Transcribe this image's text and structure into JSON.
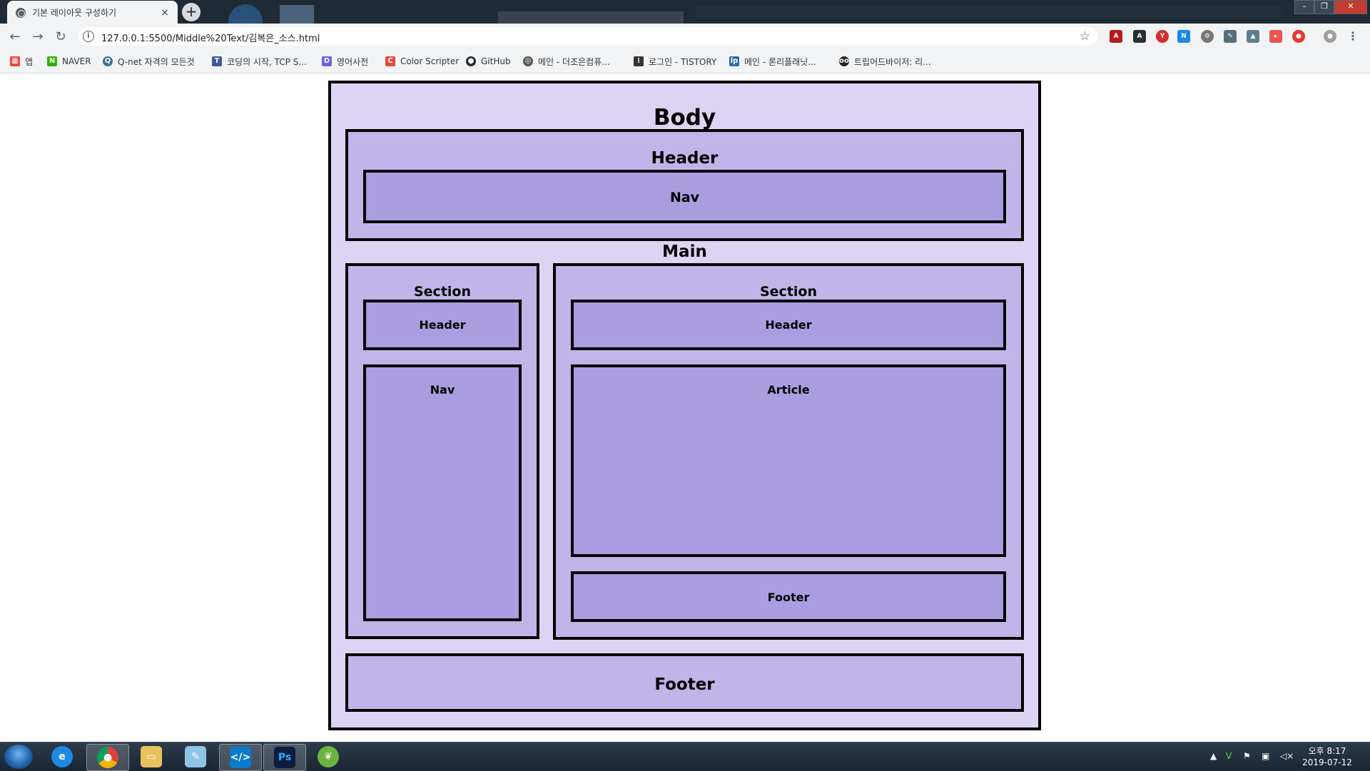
{
  "browser": {
    "tab_title": "기본 레이아웃 구성하기",
    "tab_close": "×",
    "new_tab": "+",
    "url": "127.0.0.1:5500/Middle%20Text/김복은_소스.html",
    "window_controls": [
      "–",
      "❐",
      "✕"
    ],
    "bookmarks": [
      {
        "label": "앱",
        "icon": "apps-grid-icon",
        "color": "#e8453c"
      },
      {
        "label": "NAVER",
        "icon": "naver-icon",
        "color": "#2db400"
      },
      {
        "label": "Q-net 자격의 모든것",
        "icon": "qnet-icon",
        "color": "#3a6f8f"
      },
      {
        "label": "코딩의 시작, TCP S...",
        "icon": "tcp-school-icon",
        "color": "#3b5b9a"
      },
      {
        "label": "영어사전",
        "icon": "dictionary-icon",
        "color": "#6c5ce7"
      },
      {
        "label": "Color Scripter",
        "icon": "color-scripter-icon",
        "color": "#e24a3a"
      },
      {
        "label": "GitHub",
        "icon": "github-icon",
        "color": "#24292e"
      },
      {
        "label": "메인 - 더조은컴퓨...",
        "icon": "globe-icon",
        "color": "#555555"
      },
      {
        "label": "로그인 - TISTORY",
        "icon": "tistory-icon",
        "color": "#333333"
      },
      {
        "label": "메인 - 론리플래닛...",
        "icon": "lonelyplanet-icon",
        "color": "#2b6cb0"
      },
      {
        "label": "트립어드바이저: 리...",
        "icon": "tripadvisor-icon",
        "color": "#222222"
      }
    ]
  },
  "page": {
    "body": "Body",
    "outer_header": "Header",
    "outer_nav": "Nav",
    "main": "Main",
    "left_section": {
      "title": "Section",
      "header": "Header",
      "nav": "Nav"
    },
    "right_section": {
      "title": "Section",
      "header": "Header",
      "article": "Article",
      "footer": "Footer"
    },
    "outer_footer": "Footer",
    "colors": {
      "body_bg": "#dcd4f2",
      "block_bg": "#c0b4e8",
      "inner_bg": "#aa9de0",
      "border": "#000000"
    }
  },
  "taskbar": {
    "apps": [
      "internet-explorer",
      "chrome",
      "file-explorer",
      "notepad",
      "vs-code",
      "photoshop",
      "spring-tool"
    ],
    "clock_time": "오후 8:17",
    "clock_date": "2019-07-12"
  }
}
